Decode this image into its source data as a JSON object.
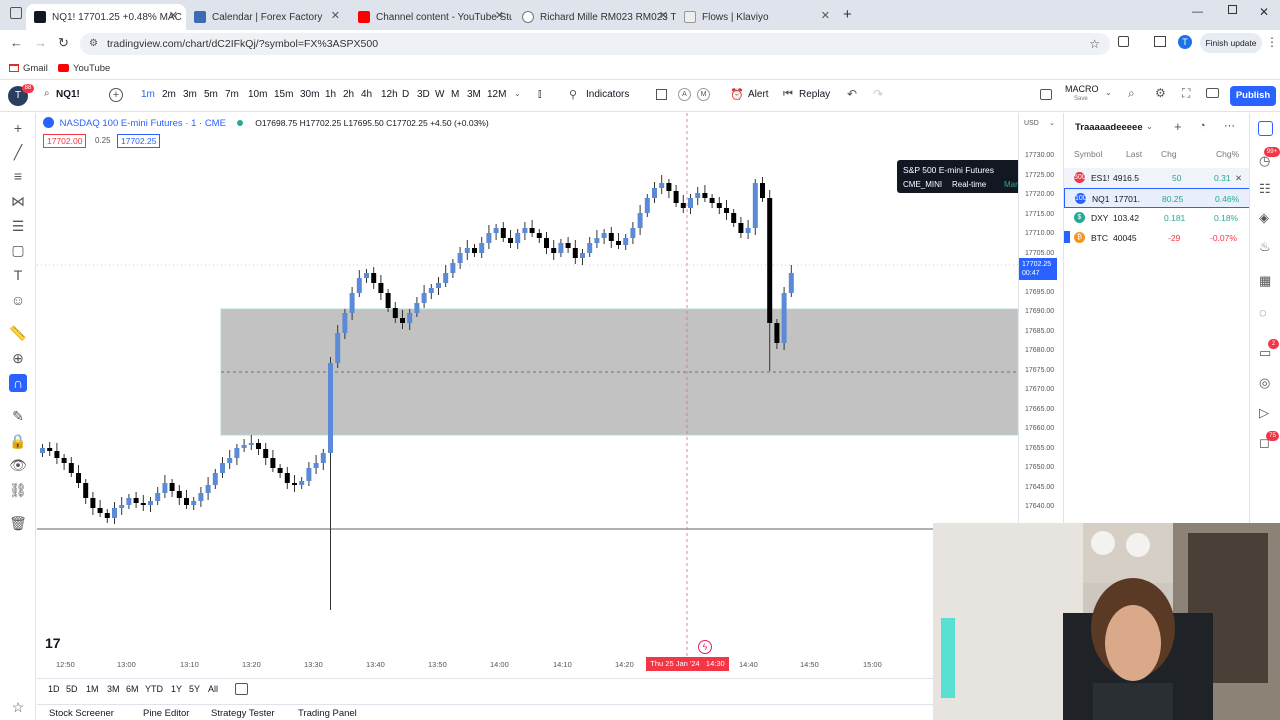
{
  "browser": {
    "tabs": [
      {
        "title": "NQ1! 17701.25 +0.48% MAC",
        "active": true
      },
      {
        "title": "Calendar | Forex Factory",
        "active": false
      },
      {
        "title": "Channel content - YouTube Stu",
        "active": false
      },
      {
        "title": "Richard Mille RM023 RM023 Tit",
        "active": false
      },
      {
        "title": "Flows | Klaviyo",
        "active": false
      }
    ],
    "url": "tradingview.com/chart/dC2IFkQj/?symbol=FX%3ASPX500",
    "finish_update": "Finish update",
    "profile_initial": "T",
    "bookmarks": [
      "Gmail",
      "YouTube"
    ]
  },
  "toolbar": {
    "symbol": "NQ1!",
    "timeframes": [
      "1m",
      "2m",
      "3m",
      "5m",
      "7m",
      "10m",
      "15m",
      "30m",
      "1h",
      "2h",
      "4h",
      "12h",
      "D",
      "3D",
      "W",
      "M",
      "3M",
      "12M"
    ],
    "indicators": "Indicators",
    "alert": "Alert",
    "replay": "Replay",
    "layout_name": "MACRO",
    "layout_sub": "Save",
    "publish": "Publish",
    "avatar_badge": "88"
  },
  "legend": {
    "title": "NASDAQ 100 E-mini Futures · 1 · CME",
    "ohlc": "O17698.75 H17702.25 L17695.50 C17702.25 +4.50 (+0.03%)",
    "bid": "17702.00",
    "spread": "0.25",
    "ask": "17702.25"
  },
  "price_axis": {
    "currency": "USD",
    "ticks": [
      "17730.00",
      "17725.00",
      "17720.00",
      "17715.00",
      "17710.00",
      "17705.00",
      "17700.00",
      "17695.00",
      "17690.00",
      "17685.00",
      "17680.00",
      "17675.00",
      "17670.00",
      "17665.00",
      "17660.00",
      "17655.00",
      "17650.00",
      "17645.00",
      "17640.00"
    ],
    "current_price": "17702.25",
    "countdown": "00:47"
  },
  "time_axis": {
    "ticks": [
      "12:50",
      "13:00",
      "13:10",
      "13:20",
      "13:30",
      "13:40",
      "13:50",
      "14:00",
      "14:10",
      "14:20",
      "14:40",
      "14:50",
      "15:00"
    ],
    "cursor_label": "Thu 25 Jan '24   14:30"
  },
  "tooltip": {
    "title": "S&P 500 E-mini Futures",
    "exchange": "CME_MINI",
    "mode": "Real-time",
    "status": "Market open"
  },
  "watchlist": {
    "name": "Traaaaadeeeee",
    "columns": [
      "Symbol",
      "Last",
      "Chg",
      "Chg%"
    ],
    "rows": [
      {
        "symbol": "ES1!",
        "last": "4916.5",
        "chg": "50",
        "chgp": "0.31",
        "color": "#f23645"
      },
      {
        "symbol": "NQ1",
        "last": "17701.",
        "chg": "80.25",
        "chgp": "0.46%",
        "color": "#f23645"
      },
      {
        "symbol": "DXY",
        "last": "103.42",
        "chg": "0.181",
        "chgp": "0.18%",
        "color": "#22ab94"
      },
      {
        "symbol": "BTC",
        "last": "40045",
        "chg": "-29",
        "chgp": "-0.07%",
        "color": "#f7931a"
      }
    ]
  },
  "range_buttons": [
    "1D",
    "5D",
    "1M",
    "3M",
    "6M",
    "YTD",
    "1Y",
    "5Y",
    "All"
  ],
  "bottom_tabs": [
    "Stock Screener",
    "Pine Editor",
    "Strategy Tester",
    "Trading Panel"
  ],
  "right_badges": [
    "99+",
    "2",
    "75"
  ],
  "colors": {
    "up": "#5b8ad6",
    "down": "#000000",
    "zone": "#b8b8b8",
    "accent": "#2962ff",
    "cursor_label": "#f23645"
  }
}
